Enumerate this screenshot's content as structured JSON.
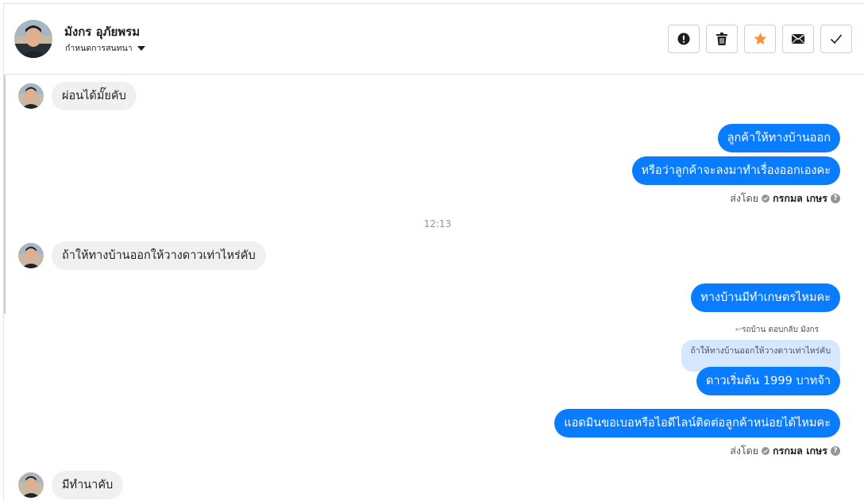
{
  "contact": {
    "name": "มังกร อุภัยพรม",
    "subtitle": "กำหนดการสนทนา"
  },
  "header_actions": [
    {
      "name": "report-button",
      "icon": "exclamation-icon"
    },
    {
      "name": "delete-button",
      "icon": "trash-icon"
    },
    {
      "name": "star-button",
      "icon": "star-icon",
      "color": "#f7923b"
    },
    {
      "name": "mark-unread-button",
      "icon": "envelope-icon"
    },
    {
      "name": "mark-done-button",
      "icon": "check-icon"
    }
  ],
  "messages": {
    "in_1": "ผ่อนได้มั๊ยคับ",
    "out_1": "ลูกค้าให้ทางบ้านออก",
    "out_2": "หรือว่าลูกค้าจะลงมาทำเรื่องออกเองคะ",
    "sent_by_1": {
      "prefix": "ส่งโดย",
      "agent": "กรกมล เกษร"
    },
    "time_1": "12:13",
    "in_2": "ถ้าให้ทางบ้านออกให้วางดาวเท่าไหร่คับ",
    "out_3": "ทางบ้านมีทำเกษตรไหมคะ",
    "reply_label": "รถบ้าน ตอบกลับ มังกร",
    "reply_quote": "ถ้าให้ทางบ้านออกให้วางดาวเท่าไหร่คับ",
    "out_4": "ดาวเริ่มต้น 1999 บาทจ้า",
    "out_5": "แอดมินขอเบอหรือไอดีไลน์ติดต่อลูกค้าหน่อยได้ไหมคะ",
    "sent_by_2": {
      "prefix": "ส่งโดย",
      "agent": "กรกมล เกษร"
    },
    "in_3": "มีทำนาคับ"
  },
  "colors": {
    "outgoing_bubble": "#0a7cff",
    "incoming_bubble": "#f0f0f0",
    "quote_bubble": "#d6e8ff"
  }
}
